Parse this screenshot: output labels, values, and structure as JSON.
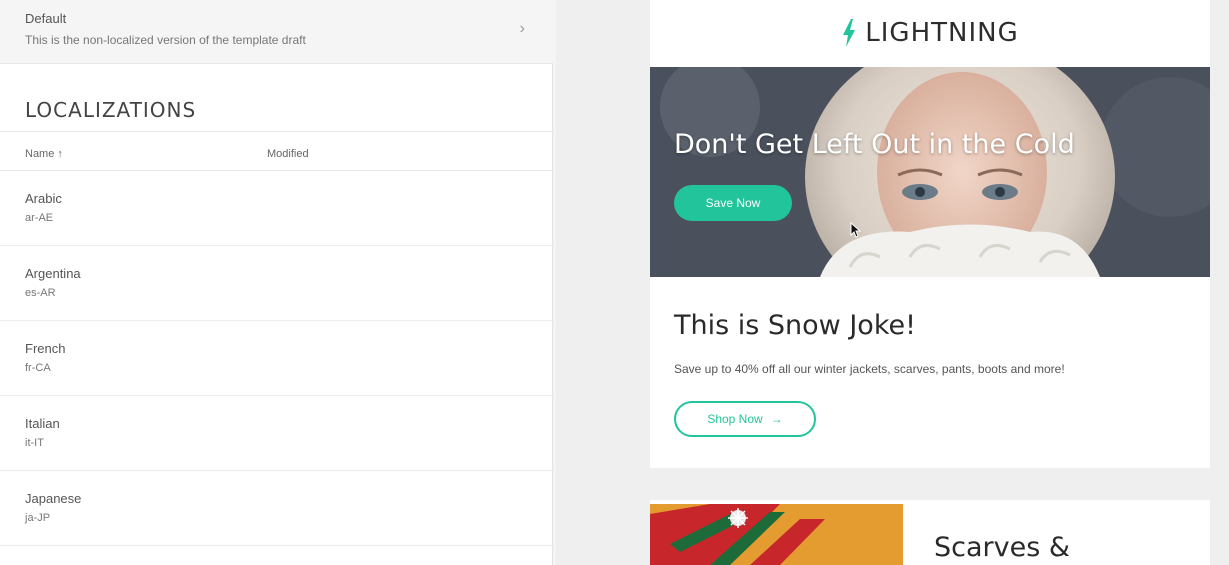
{
  "default_row": {
    "title": "Default",
    "subtitle": "This is the non-localized version of the template draft",
    "chevron": "chevron-right-icon"
  },
  "localizations": {
    "heading": "LOCALIZATIONS",
    "columns": {
      "name": "Name ↑",
      "modified": "Modified"
    },
    "items": [
      {
        "name": "Arabic",
        "code": "ar-AE"
      },
      {
        "name": "Argentina",
        "code": "es-AR"
      },
      {
        "name": "French",
        "code": "fr-CA"
      },
      {
        "name": "Italian",
        "code": "it-IT"
      },
      {
        "name": "Japanese",
        "code": "ja-JP"
      }
    ]
  },
  "preview": {
    "logo_text": "LIGHTNING",
    "logo_icon": "lightning-bolt-icon",
    "hero_headline": "Don't Get Left Out in the Cold",
    "save_button": "Save Now",
    "section_title": "This is Snow Joke!",
    "section_desc": "Save up to 40% off all our winter jackets, scarves, pants, boots and more!",
    "shop_button": "Shop Now",
    "shop_arrow": "→",
    "second_title": "Scarves &"
  },
  "colors": {
    "accent": "#22c49b",
    "left_bg": "#ffffff",
    "right_bg": "#efefef"
  }
}
